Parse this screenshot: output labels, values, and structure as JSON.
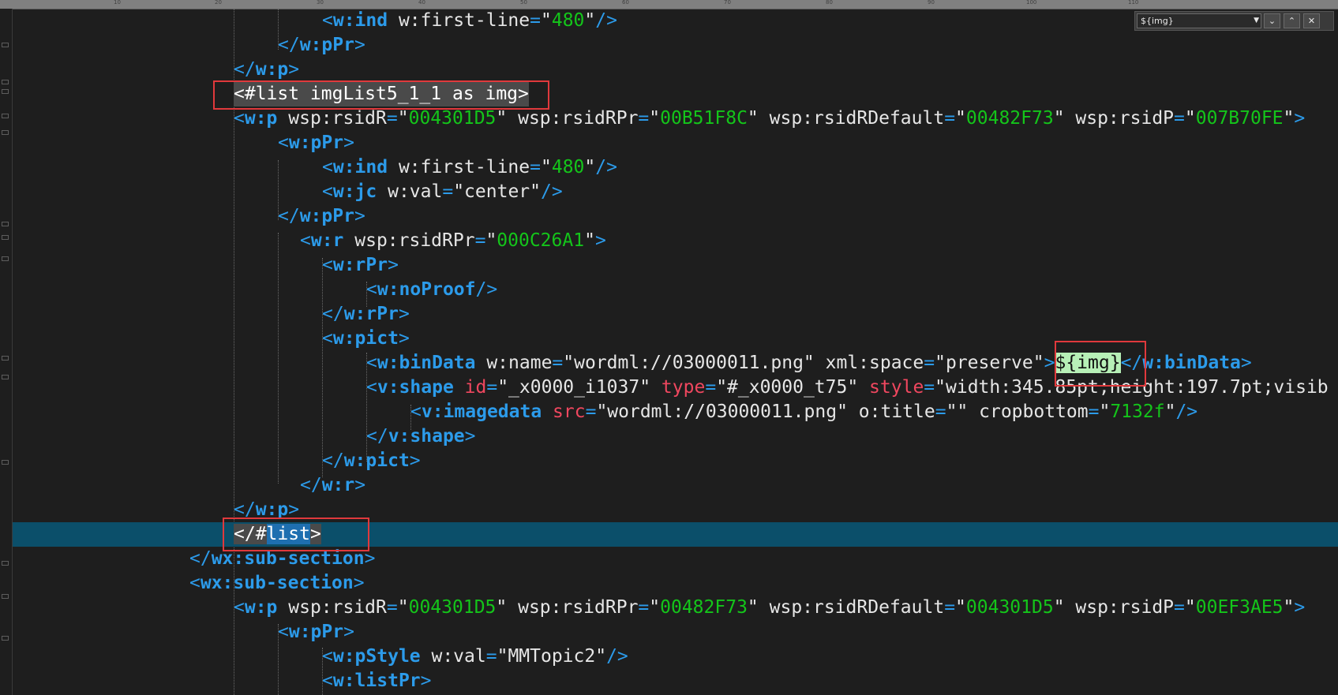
{
  "ruler": {
    "ticks": [
      "10",
      "20",
      "30",
      "40",
      "50",
      "60",
      "70",
      "80",
      "90",
      "100",
      "110"
    ]
  },
  "find": {
    "query": "${img}",
    "dropdown_icon": "chevron-down-icon",
    "down_icon": "arrow-down-icon",
    "up_icon": "arrow-up-icon",
    "close_icon": "close-icon"
  },
  "colors": {
    "tag": "#2c9bea",
    "attr_value": "#14c51a",
    "current_line": "#0b4f6a",
    "annotation_box": "#e0393c"
  },
  "lines": {
    "l1": [
      "<",
      "w:ind",
      " w:first-line",
      "=",
      "\"",
      "480",
      "\"",
      "/>"
    ],
    "l2": [
      "</",
      "w:pPr",
      ">"
    ],
    "l3": [
      "</",
      "w:p",
      ">"
    ],
    "l4": [
      "<#list imgList5_1_1 as img>"
    ],
    "l5": [
      "<",
      "w:p",
      " wsp:rsidR",
      "=",
      "\"",
      "004301D5",
      "\"",
      " wsp:rsidRPr",
      "=",
      "\"",
      "00B51F8C",
      "\"",
      " wsp:rsidRDefault",
      "=",
      "\"",
      "00482F73",
      "\"",
      " wsp:rsidP",
      "=",
      "\"",
      "007B70FE",
      "\"",
      ">"
    ],
    "l6": [
      "<",
      "w:pPr",
      ">"
    ],
    "l7": [
      "<",
      "w:ind",
      " w:first-line",
      "=",
      "\"",
      "480",
      "\"",
      "/>"
    ],
    "l8": [
      "<",
      "w:jc",
      " w:val",
      "=",
      "\"center\"",
      "/>"
    ],
    "l9": [
      "</",
      "w:pPr",
      ">"
    ],
    "l10": [
      "<",
      "w:r",
      " wsp:rsidRPr",
      "=",
      "\"",
      "000C26A1",
      "\"",
      ">"
    ],
    "l11": [
      "<",
      "w:rPr",
      ">"
    ],
    "l12": [
      "<",
      "w:noProof",
      "/>"
    ],
    "l13": [
      "</",
      "w:rPr",
      ">"
    ],
    "l14": [
      "<",
      "w:pict",
      ">"
    ],
    "l15": [
      "<",
      "w:binData",
      " w:name",
      "=",
      "\"wordml://03000011.png\"",
      " xml:space",
      "=",
      "\"preserve\"",
      ">",
      "${img}",
      "</",
      "w:binData",
      ">"
    ],
    "l16": [
      "<",
      "v:shape",
      " id",
      "=",
      "\"_x0000_i1037\"",
      " type",
      "=",
      "\"#_x0000_t75\"",
      " style",
      "=",
      "\"width:345.85pt;height:197.7pt;visib"
    ],
    "l17": [
      "<",
      "v:imagedata",
      " src",
      "=",
      "\"wordml://03000011.png\"",
      " o:title",
      "=",
      "\"\"",
      " cropbottom",
      "=",
      "\"",
      "7132f",
      "\"",
      "/>"
    ],
    "l18": [
      "</",
      "v:shape",
      ">"
    ],
    "l19": [
      "</",
      "w:pict",
      ">"
    ],
    "l20": [
      "</",
      "w:r",
      ">"
    ],
    "l21": [
      "</",
      "w:p",
      ">"
    ],
    "l22": [
      "</#",
      "list",
      ">"
    ],
    "l23": [
      "</",
      "wx:sub-section",
      ">"
    ],
    "l24": [
      "<",
      "wx:sub-section",
      ">"
    ],
    "l25": [
      "<",
      "w:p",
      " wsp:rsidR",
      "=",
      "\"",
      "004301D5",
      "\"",
      " wsp:rsidRPr",
      "=",
      "\"",
      "00482F73",
      "\"",
      " wsp:rsidRDefault",
      "=",
      "\"",
      "004301D5",
      "\"",
      " wsp:rsidP",
      "=",
      "\"",
      "00EF3AE5",
      "\"",
      ">"
    ],
    "l26": [
      "<",
      "w:pPr",
      ">"
    ],
    "l27": [
      "<",
      "w:pStyle",
      " w:val",
      "=",
      "\"MMTopic2\"",
      "/>"
    ],
    "l28": [
      "<",
      "w:listPr",
      ">"
    ]
  }
}
